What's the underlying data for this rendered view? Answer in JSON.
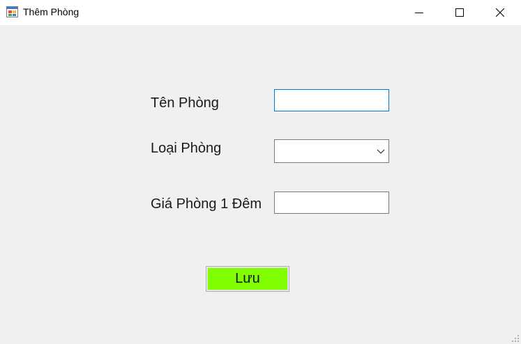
{
  "window": {
    "title": "Thêm Phòng",
    "icon": "form-app-icon",
    "controls": {
      "minimize": "minimize-icon",
      "maximize": "maximize-icon",
      "close": "close-icon"
    }
  },
  "form": {
    "room_name": {
      "label": "Tên Phòng",
      "value": "",
      "placeholder": ""
    },
    "room_type": {
      "label": "Loại Phòng",
      "selected": "",
      "icon": "chevron-down-icon"
    },
    "price_per_night": {
      "label": "Giá Phòng 1 Đêm",
      "value": "",
      "placeholder": ""
    },
    "save_label": "Lưu"
  },
  "colors": {
    "save_button": "#80ff00",
    "focus_border": "#0078d7",
    "background": "#f0f0f0"
  }
}
